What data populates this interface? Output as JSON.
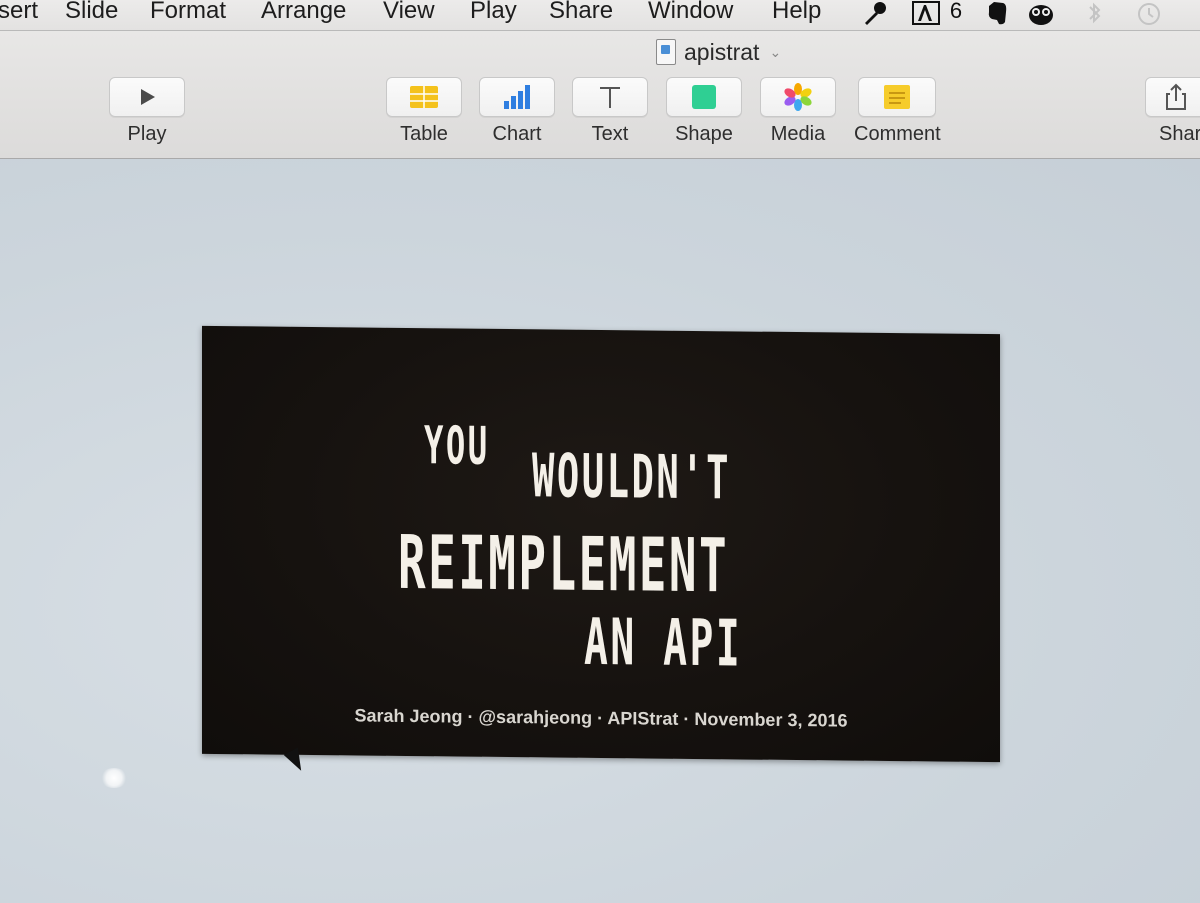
{
  "menubar": {
    "items": [
      "sert",
      "Slide",
      "Format",
      "Arrange",
      "View",
      "Play",
      "Share",
      "Window",
      "Help"
    ],
    "status_text": "6"
  },
  "window": {
    "title": "apistrat"
  },
  "toolbar": {
    "play_label": "Play",
    "table_label": "Table",
    "chart_label": "Chart",
    "text_label": "Text",
    "shape_label": "Shape",
    "media_label": "Media",
    "comment_label": "Comment",
    "share_label": "Shar"
  },
  "slide": {
    "line1_word1": "YOU",
    "line1_word2": "WOULDN'T",
    "line2": "REIMPLEMENT",
    "line3": "AN API",
    "footer": "Sarah Jeong · @sarahjeong · APIStrat · November 3, 2016"
  },
  "colors": {
    "slide_background": "#16120f",
    "slide_text": "#f4f0e8",
    "toolbar_background": "#e3e2e1",
    "table_icon": "#f4c21c",
    "chart_icon": "#2f7ee0",
    "shape_icon": "#2fcf93",
    "comment_icon": "#f6cc2b"
  }
}
